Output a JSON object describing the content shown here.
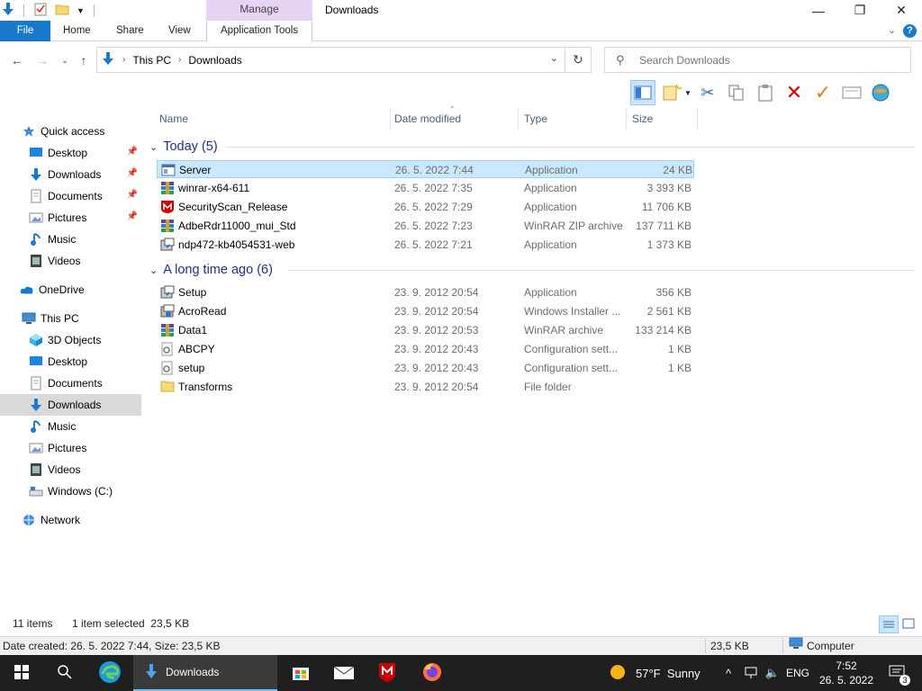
{
  "window": {
    "title": "Downloads",
    "manage_label": "Manage",
    "controls": {
      "minimize": "—",
      "maximize": "❐",
      "close": "✕"
    }
  },
  "ribbon": {
    "tabs": [
      "File",
      "Home",
      "Share",
      "View",
      "Application Tools"
    ],
    "help": "?"
  },
  "address": {
    "crumbs": [
      "This PC",
      "Downloads"
    ],
    "refresh": "↻"
  },
  "search": {
    "placeholder": "Search Downloads"
  },
  "navpane": {
    "items": [
      {
        "label": "Quick access",
        "icon": "star-icon",
        "pinned": false
      },
      {
        "label": "Desktop",
        "icon": "desktop-icon",
        "pinned": true
      },
      {
        "label": "Downloads",
        "icon": "download-icon",
        "pinned": true
      },
      {
        "label": "Documents",
        "icon": "documents-icon",
        "pinned": true
      },
      {
        "label": "Pictures",
        "icon": "pictures-icon",
        "pinned": true
      },
      {
        "label": "Music",
        "icon": "music-icon",
        "pinned": false
      },
      {
        "label": "Videos",
        "icon": "videos-icon",
        "pinned": false
      },
      {
        "label": "OneDrive",
        "icon": "cloud-icon",
        "pinned": false
      },
      {
        "label": "This PC",
        "icon": "computer-icon",
        "pinned": false
      },
      {
        "label": "3D Objects",
        "icon": "cube-icon",
        "pinned": false
      },
      {
        "label": "Desktop",
        "icon": "desktop-icon",
        "pinned": false
      },
      {
        "label": "Documents",
        "icon": "documents-icon",
        "pinned": false
      },
      {
        "label": "Downloads",
        "icon": "download-icon",
        "pinned": false
      },
      {
        "label": "Music",
        "icon": "music-icon",
        "pinned": false
      },
      {
        "label": "Pictures",
        "icon": "pictures-icon",
        "pinned": false
      },
      {
        "label": "Videos",
        "icon": "videos-icon",
        "pinned": false
      },
      {
        "label": "Windows (C:)",
        "icon": "drive-icon",
        "pinned": false
      },
      {
        "label": "Network",
        "icon": "network-icon",
        "pinned": false
      }
    ]
  },
  "columns": {
    "name": "Name",
    "date": "Date modified",
    "type": "Type",
    "size": "Size"
  },
  "groups": [
    {
      "title": "Today (5)",
      "files": [
        {
          "name": "Server",
          "date": "26. 5. 2022 7:44",
          "type": "Application",
          "size": "24 KB",
          "icon": "app-icon"
        },
        {
          "name": "winrar-x64-611",
          "date": "26. 5. 2022 7:35",
          "type": "Application",
          "size": "3 393 KB",
          "icon": "winrar-icon"
        },
        {
          "name": "SecurityScan_Release",
          "date": "26. 5. 2022 7:29",
          "type": "Application",
          "size": "11 706 KB",
          "icon": "mcafee-icon"
        },
        {
          "name": "AdbeRdr11000_mui_Std",
          "date": "26. 5. 2022 7:23",
          "type": "WinRAR ZIP archive",
          "size": "137 711 KB",
          "icon": "winrar-icon"
        },
        {
          "name": "ndp472-kb4054531-web",
          "date": "26. 5. 2022 7:21",
          "type": "Application",
          "size": "1 373 KB",
          "icon": "installer-icon"
        }
      ]
    },
    {
      "title": "A long time ago (6)",
      "files": [
        {
          "name": "Setup",
          "date": "23. 9. 2012 20:54",
          "type": "Application",
          "size": "356 KB",
          "icon": "installer-icon"
        },
        {
          "name": "AcroRead",
          "date": "23. 9. 2012 20:54",
          "type": "Windows Installer ...",
          "size": "2 561 KB",
          "icon": "msi-icon"
        },
        {
          "name": "Data1",
          "date": "23. 9. 2012 20:53",
          "type": "WinRAR archive",
          "size": "133 214 KB",
          "icon": "winrar-icon"
        },
        {
          "name": "ABCPY",
          "date": "23. 9. 2012 20:43",
          "type": "Configuration sett...",
          "size": "1 KB",
          "icon": "config-icon"
        },
        {
          "name": "setup",
          "date": "23. 9. 2012 20:43",
          "type": "Configuration sett...",
          "size": "1 KB",
          "icon": "config-icon"
        },
        {
          "name": "Transforms",
          "date": "23. 9. 2012 20:54",
          "type": "File folder",
          "size": "",
          "icon": "folder-icon"
        }
      ]
    }
  ],
  "status": {
    "items": "11 items",
    "selected": "1 item selected  23,5 KB"
  },
  "details": {
    "info": "Date created: 26. 5. 2022 7:44, Size: 23,5 KB",
    "size": "23,5 KB",
    "location": "Computer"
  },
  "taskbar": {
    "active_label": "Downloads",
    "weather": "57°F  Sunny",
    "lang": "ENG",
    "time": "7:52",
    "date": "26. 5. 2022",
    "notif_count": "3"
  }
}
